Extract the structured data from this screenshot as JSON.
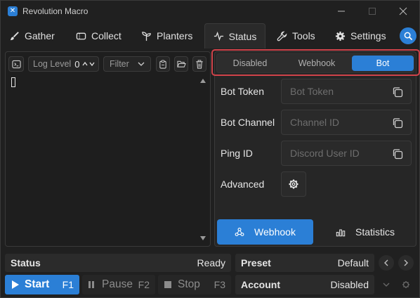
{
  "window": {
    "title": "Revolution Macro"
  },
  "nav": {
    "tabs": [
      {
        "label": "Gather",
        "icon": "brush-icon"
      },
      {
        "label": "Collect",
        "icon": "ticket-icon"
      },
      {
        "label": "Planters",
        "icon": "plant-icon"
      },
      {
        "label": "Status",
        "icon": "pulse-icon",
        "active": true
      },
      {
        "label": "Tools",
        "icon": "wrench-icon"
      },
      {
        "label": "Settings",
        "icon": "gear-icon"
      }
    ]
  },
  "log": {
    "log_level_label": "Log Level",
    "log_level_value": "0",
    "filter_label": "Filter"
  },
  "status_panel": {
    "modes": [
      "Disabled",
      "Webhook",
      "Bot"
    ],
    "active_mode": "Bot",
    "fields": [
      {
        "label": "Bot Token",
        "placeholder": "Bot Token"
      },
      {
        "label": "Bot Channel",
        "placeholder": "Channel ID"
      },
      {
        "label": "Ping ID",
        "placeholder": "Discord User ID"
      }
    ],
    "advanced_label": "Advanced",
    "webhook_button": "Webhook",
    "statistics_button": "Statistics"
  },
  "footer": {
    "status_label": "Status",
    "status_value": "Ready",
    "preset_label": "Preset",
    "preset_value": "Default",
    "account_label": "Account",
    "account_value": "Disabled",
    "start_label": "Start",
    "start_key": "F1",
    "pause_label": "Pause",
    "pause_key": "F2",
    "stop_label": "Stop",
    "stop_key": "F3"
  },
  "colors": {
    "accent": "#2b7fd6",
    "highlight": "#d0434a",
    "background": "#202020"
  }
}
